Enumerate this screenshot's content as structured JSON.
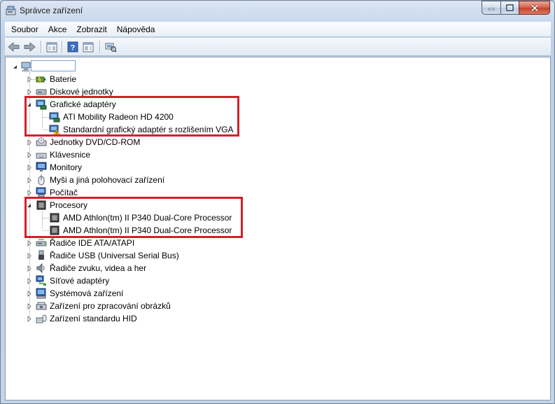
{
  "window": {
    "title": "Správce zařízení"
  },
  "menu": [
    "Soubor",
    "Akce",
    "Zobrazit",
    "Nápověda"
  ],
  "toolbar": {
    "buttons": [
      "back-icon",
      "forward-icon",
      "properties-pane-icon",
      "help-icon",
      "action-pane-icon",
      "scan-hardware-icon"
    ]
  },
  "tree": {
    "root": {
      "label": ""
    },
    "categories": [
      {
        "label": "Baterie",
        "icon": "battery-icon",
        "expanded": false
      },
      {
        "label": "Diskové jednotky",
        "icon": "disk-drive-icon",
        "expanded": false
      },
      {
        "label": "Grafické adaptéry",
        "icon": "display-adapter-icon",
        "expanded": true,
        "children": [
          {
            "label": "ATI Mobility Radeon HD 4200",
            "icon": "display-adapter-icon",
            "warning": false
          },
          {
            "label": "Standardní grafický adaptér s rozlišením VGA",
            "icon": "display-adapter-warning-icon",
            "warning": true
          }
        ]
      },
      {
        "label": "Jednotky DVD/CD-ROM",
        "icon": "dvd-drive-icon",
        "expanded": false
      },
      {
        "label": "Klávesnice",
        "icon": "keyboard-icon",
        "expanded": false
      },
      {
        "label": "Monitory",
        "icon": "monitor-icon",
        "expanded": false
      },
      {
        "label": "Myši a jiná polohovací zařízení",
        "icon": "mouse-icon",
        "expanded": false
      },
      {
        "label": "Počítač",
        "icon": "computer-icon",
        "expanded": false
      },
      {
        "label": "Procesory",
        "icon": "processor-icon",
        "expanded": true,
        "children": [
          {
            "label": "AMD Athlon(tm) II P340 Dual-Core Processor",
            "icon": "processor-icon"
          },
          {
            "label": "AMD Athlon(tm) II P340 Dual-Core Processor",
            "icon": "processor-icon"
          }
        ]
      },
      {
        "label": "Řadiče IDE ATA/ATAPI",
        "icon": "ide-controller-icon",
        "expanded": false
      },
      {
        "label": "Řadiče USB (Universal Serial Bus)",
        "icon": "usb-icon",
        "expanded": false
      },
      {
        "label": "Řadiče zvuku, videa a her",
        "icon": "sound-icon",
        "expanded": false
      },
      {
        "label": "Síťové adaptéry",
        "icon": "network-adapter-icon",
        "expanded": false
      },
      {
        "label": "Systémová zařízení",
        "icon": "system-device-icon",
        "expanded": false
      },
      {
        "label": "Zařízení pro zpracování obrázků",
        "icon": "imaging-device-icon",
        "expanded": false
      },
      {
        "label": "Zařízení standardu HID",
        "icon": "hid-icon",
        "expanded": false
      }
    ]
  },
  "colors": {
    "highlight": "#d4202a",
    "selection_border": "#7aa0cf"
  }
}
